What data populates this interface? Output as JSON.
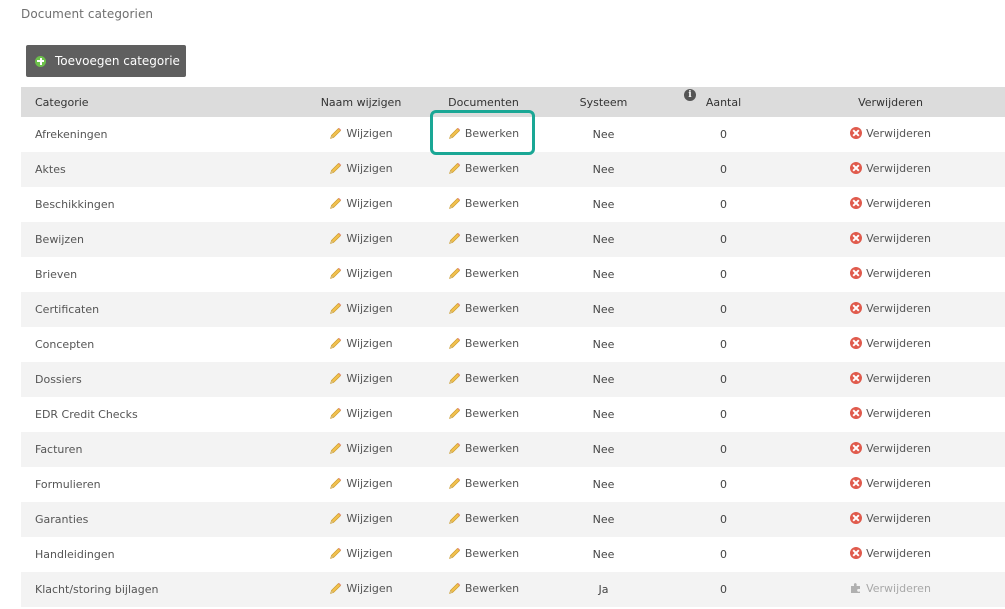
{
  "page": {
    "title": "Document categorien"
  },
  "toolbar": {
    "add_label": "Toevoegen categorie",
    "add_icon": "plus-circle-icon"
  },
  "table": {
    "columns": [
      "Categorie",
      "Naam wijzigen",
      "Documenten",
      "Systeem",
      "Aantal",
      "Verwijderen"
    ],
    "rows": [
      {
        "name": "Afrekeningen",
        "rename": "Wijzigen",
        "docs": "Bewerken",
        "system": "Nee",
        "count": "0",
        "delete": "Verwijderen"
      },
      {
        "name": "Aktes",
        "rename": "Wijzigen",
        "docs": "Bewerken",
        "system": "Nee",
        "count": "0",
        "delete": "Verwijderen"
      },
      {
        "name": "Beschikkingen",
        "rename": "Wijzigen",
        "docs": "Bewerken",
        "system": "Nee",
        "count": "0",
        "delete": "Verwijderen"
      },
      {
        "name": "Bewijzen",
        "rename": "Wijzigen",
        "docs": "Bewerken",
        "system": "Nee",
        "count": "0",
        "delete": "Verwijderen"
      },
      {
        "name": "Brieven",
        "rename": "Wijzigen",
        "docs": "Bewerken",
        "system": "Nee",
        "count": "0",
        "delete": "Verwijderen"
      },
      {
        "name": "Certificaten",
        "rename": "Wijzigen",
        "docs": "Bewerken",
        "system": "Nee",
        "count": "0",
        "delete": "Verwijderen"
      },
      {
        "name": "Concepten",
        "rename": "Wijzigen",
        "docs": "Bewerken",
        "system": "Nee",
        "count": "0",
        "delete": "Verwijderen"
      },
      {
        "name": "Dossiers",
        "rename": "Wijzigen",
        "docs": "Bewerken",
        "system": "Nee",
        "count": "0",
        "delete": "Verwijderen"
      },
      {
        "name": "EDR Credit Checks",
        "rename": "Wijzigen",
        "docs": "Bewerken",
        "system": "Nee",
        "count": "0",
        "delete": "Verwijderen"
      },
      {
        "name": "Facturen",
        "rename": "Wijzigen",
        "docs": "Bewerken",
        "system": "Nee",
        "count": "0",
        "delete": "Verwijderen"
      },
      {
        "name": "Formulieren",
        "rename": "Wijzigen",
        "docs": "Bewerken",
        "system": "Nee",
        "count": "0",
        "delete": "Verwijderen"
      },
      {
        "name": "Garanties",
        "rename": "Wijzigen",
        "docs": "Bewerken",
        "system": "Nee",
        "count": "0",
        "delete": "Verwijderen"
      },
      {
        "name": "Handleidingen",
        "rename": "Wijzigen",
        "docs": "Bewerken",
        "system": "Nee",
        "count": "0",
        "delete": "Verwijderen"
      },
      {
        "name": "Klacht/storing bijlagen",
        "rename": "Wijzigen",
        "docs": "Bewerken",
        "system": "Ja",
        "count": "0",
        "delete": "Verwijderen",
        "delete_disabled": true
      }
    ]
  },
  "icons": {
    "rename": "pencil-icon",
    "docs": "pencil-icon",
    "delete": "delete-x-icon",
    "delete_disabled": "puzzle-icon",
    "aantal_info": "info-icon"
  },
  "colors": {
    "button_bg": "#5f5f5f",
    "header_bg": "#dcdcdc",
    "stripe_bg": "#f3f3f3",
    "delete_red": "#e05a4c",
    "highlight": "#1aa795",
    "add_green": "#6cc04a"
  }
}
